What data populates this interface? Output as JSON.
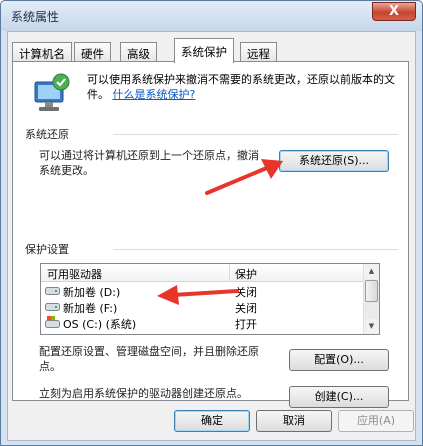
{
  "window": {
    "title": "系统属性",
    "close_glyph": "X"
  },
  "tabs": [
    {
      "label": "计算机名",
      "active": false
    },
    {
      "label": "硬件",
      "active": false
    },
    {
      "label": "高级",
      "active": false
    },
    {
      "label": "系统保护",
      "active": true
    },
    {
      "label": "远程",
      "active": false
    }
  ],
  "intro": {
    "text": "可以使用系统保护来撤消不需要的系统更改，还原以前版本的文件。",
    "link": "什么是系统保护?"
  },
  "restore": {
    "section_label": "系统还原",
    "description": "可以通过将计算机还原到上一个还原点，撤消系统更改。",
    "button_label": "系统还原(S)..."
  },
  "protection": {
    "section_label": "保护设置",
    "columns": [
      "可用驱动器",
      "保护"
    ],
    "drives": [
      {
        "name": "新加卷 (D:)",
        "status": "关闭",
        "icon": "drive-icon"
      },
      {
        "name": "新加卷 (F:)",
        "status": "关闭",
        "icon": "drive-icon"
      },
      {
        "name": "OS (C:) (系统)",
        "status": "打开",
        "icon": "system-drive-icon"
      }
    ],
    "configure_text": "配置还原设置、管理磁盘空间，并且删除还原点。",
    "configure_button": "配置(O)...",
    "create_text": "立刻为启用系统保护的驱动器创建还原点。",
    "create_button": "创建(C)..."
  },
  "footer": {
    "ok": "确定",
    "cancel": "取消",
    "apply": "应用(A)"
  },
  "colors": {
    "arrow": "#e8342b",
    "link": "#0a58c2"
  }
}
